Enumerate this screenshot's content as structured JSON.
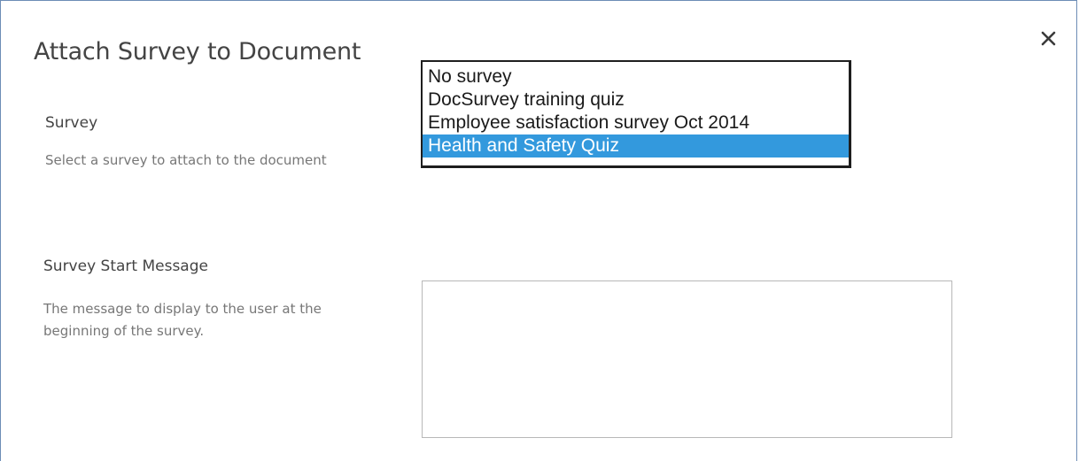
{
  "dialog": {
    "title": "Attach Survey to Document",
    "close_glyph": "×"
  },
  "survey_section": {
    "label": "Survey",
    "description": "Select a survey to attach to the document",
    "dropdown": {
      "options": [
        "No survey",
        "DocSurvey training quiz",
        "Employee satisfaction survey Oct 2014",
        "Health and Safety Quiz"
      ],
      "selected": "Health and Safety Quiz",
      "highlight_color": "#3399dd"
    }
  },
  "start_message_section": {
    "label": "Survey Start Message",
    "description": "The message to display to the user at the beginning of the survey.",
    "value": ""
  },
  "icons": {
    "close": "close-icon"
  }
}
